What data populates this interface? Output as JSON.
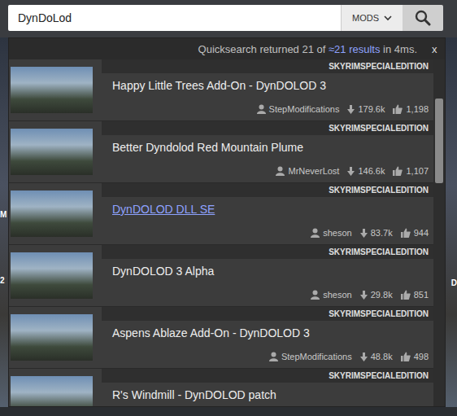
{
  "search": {
    "value": "DynDoLod",
    "scope": "MODS"
  },
  "results_header": {
    "prefix": "Quicksearch returned 21 of",
    "link": "≈21 results",
    "suffix": "in 4ms.",
    "close": "x"
  },
  "results": [
    {
      "title": "Happy Little Trees Add-On - DynDOLOD 3",
      "game": "SKYRIMSPECIALEDITION",
      "author": "StepModifications",
      "downloads": "179.6k",
      "endorsements": "1,198",
      "hovered": false
    },
    {
      "title": "Better Dyndolod Red Mountain Plume",
      "game": "SKYRIMSPECIALEDITION",
      "author": "MrNeverLost",
      "downloads": "146.6k",
      "endorsements": "1,107",
      "hovered": false
    },
    {
      "title": "DynDOLOD DLL SE",
      "game": "SKYRIMSPECIALEDITION",
      "author": "sheson",
      "downloads": "83.7k",
      "endorsements": "944",
      "hovered": true
    },
    {
      "title": "DynDOLOD 3 Alpha",
      "game": "SKYRIMSPECIALEDITION",
      "author": "sheson",
      "downloads": "29.8k",
      "endorsements": "851",
      "hovered": false
    },
    {
      "title": "Aspens Ablaze Add-On - DynDOLOD 3",
      "game": "SKYRIMSPECIALEDITION",
      "author": "StepModifications",
      "downloads": "48.8k",
      "endorsements": "498",
      "hovered": false
    },
    {
      "title": "R's Windmill - DynDOLOD patch",
      "game": "SKYRIMSPECIALEDITION",
      "hovered": false
    }
  ],
  "scrollbar": {
    "level": 0.12
  },
  "background": {
    "left_texts": [
      "M",
      "2"
    ],
    "right_texts": [
      "D"
    ]
  }
}
